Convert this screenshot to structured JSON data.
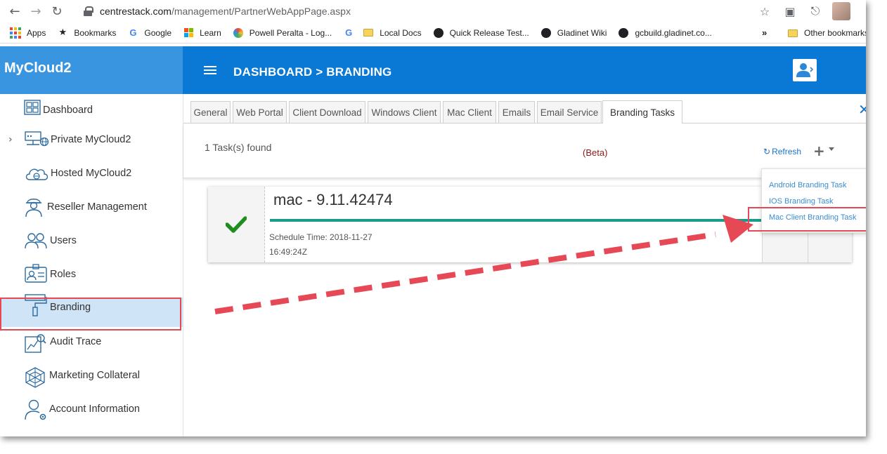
{
  "browser": {
    "url_host": "centrestack.com",
    "url_path": "/management/PartnerWebAppPage.aspx",
    "bookmarks": [
      {
        "label": "Apps",
        "icon": "apps-grid-icon"
      },
      {
        "label": "Bookmarks",
        "icon": "star-icon"
      },
      {
        "label": "Google",
        "icon": "google-icon"
      },
      {
        "label": "Learn",
        "icon": "microsoft-icon"
      },
      {
        "label": "Powell Peralta - Log...",
        "icon": "site-icon"
      },
      {
        "label": "",
        "icon": "google-icon"
      },
      {
        "label": "Local Docs",
        "icon": "folder-icon"
      },
      {
        "label": "Quick Release Test...",
        "icon": "globe-icon"
      },
      {
        "label": "Gladinet Wiki",
        "icon": "globe-icon"
      },
      {
        "label": "gcbuild.gladinet.co...",
        "icon": "globe-icon"
      }
    ],
    "more": "»",
    "other_bookmarks": "Other bookmarks"
  },
  "app": {
    "brand": "MyCloud2",
    "breadcrumb": "DASHBOARD >  BRANDING"
  },
  "sidebar": {
    "items": [
      {
        "label": "Dashboard",
        "icon": "dashboard-grid-icon"
      },
      {
        "label": "Private MyCloud2",
        "icon": "server-network-icon"
      },
      {
        "label": "Hosted MyCloud2",
        "icon": "cloud-icon"
      },
      {
        "label": "Reseller Management",
        "icon": "reseller-person-icon"
      },
      {
        "label": "Users",
        "icon": "users-icon"
      },
      {
        "label": "Roles",
        "icon": "id-card-icon"
      },
      {
        "label": "Branding",
        "icon": "paint-roller-icon"
      },
      {
        "label": "Audit Trace",
        "icon": "audit-chart-icon"
      },
      {
        "label": "Marketing Collateral",
        "icon": "web-icon"
      },
      {
        "label": "Account Information",
        "icon": "account-gear-icon"
      }
    ]
  },
  "tabs": [
    "General",
    "Web Portal",
    "Client Download",
    "Windows Client",
    "Mac Client",
    "Emails",
    "Email Service",
    "Branding Tasks"
  ],
  "toolbar": {
    "tasks_found": "1 Task(s) found",
    "beta": "(Beta)",
    "refresh": "Refresh"
  },
  "task": {
    "name": "mac - 9.11.42474",
    "schedule": "Schedule Time: 2018-11-27 16:49:24Z"
  },
  "dropdown": {
    "items": [
      "Android Branding Task",
      "IOS Branding Task",
      "Mac Client Branding Task"
    ]
  },
  "colors": {
    "sidebar_header": "#3a95e0",
    "topbar": "#0a79d6",
    "progress": "#1a9c8c",
    "annotation_red": "#e74856",
    "check_green": "#1e8e1e"
  }
}
